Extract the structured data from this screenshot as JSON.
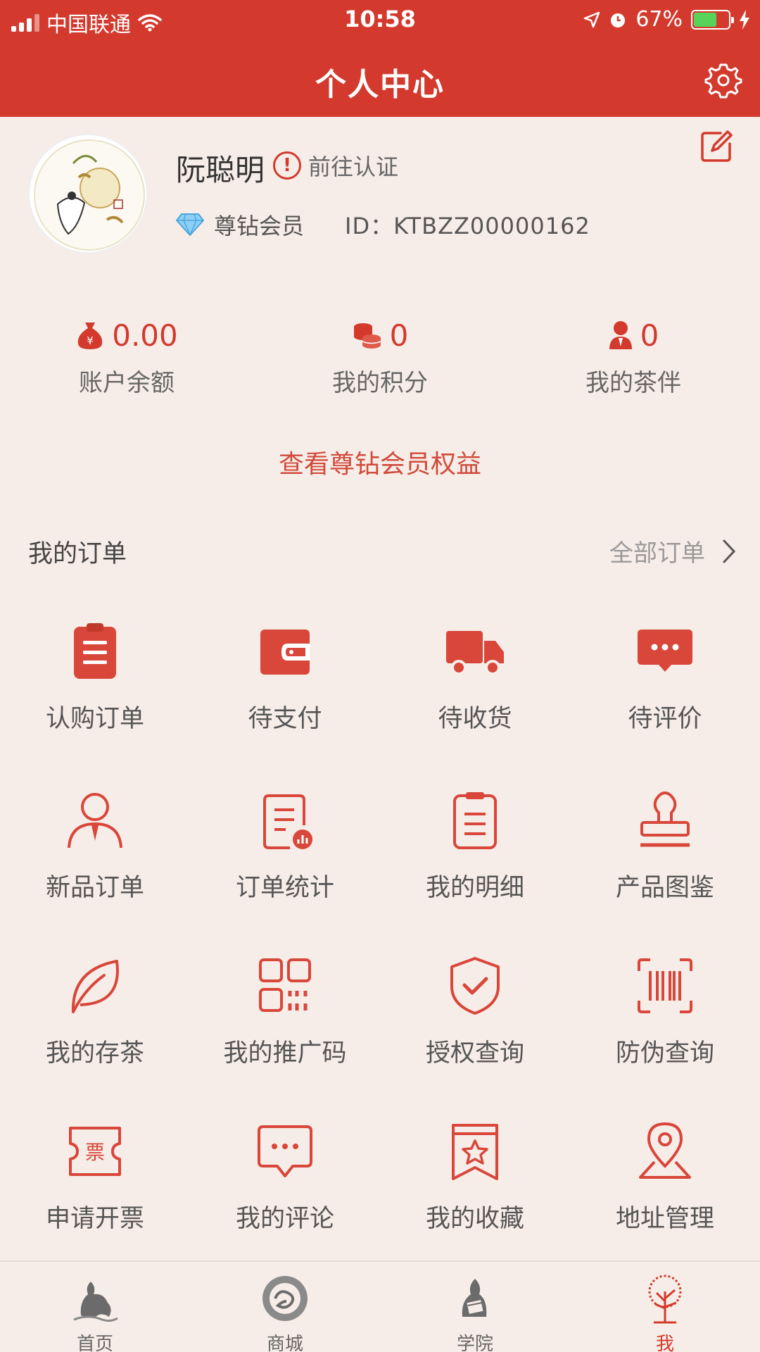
{
  "status_bar": {
    "carrier": "中国联通",
    "time": "10:58",
    "battery": "67%",
    "battery_level": 0.67
  },
  "header": {
    "title": "个人中心"
  },
  "profile": {
    "name": "阮聪明",
    "verify_label": "前往认证",
    "verify_mark": "!",
    "membership": "尊钻会员",
    "id_label": "ID：KTBZZ00000162"
  },
  "stats": [
    {
      "value": "0.00",
      "label": "账户余额",
      "icon": "money-bag-icon"
    },
    {
      "value": "0",
      "label": "我的积分",
      "icon": "coins-icon"
    },
    {
      "value": "0",
      "label": "我的茶伴",
      "icon": "person-icon"
    }
  ],
  "benefits_link": "查看尊钻会员权益",
  "orders": {
    "title": "我的订单",
    "all_label": "全部订单",
    "items": [
      {
        "label": "认购订单",
        "icon": "clipboard-icon"
      },
      {
        "label": "待支付",
        "icon": "wallet-icon"
      },
      {
        "label": "待收货",
        "icon": "truck-icon"
      },
      {
        "label": "待评价",
        "icon": "chat-bubble-icon"
      }
    ]
  },
  "services": [
    {
      "label": "新品订单",
      "icon": "user-icon"
    },
    {
      "label": "订单统计",
      "icon": "report-icon"
    },
    {
      "label": "我的明细",
      "icon": "list-icon"
    },
    {
      "label": "产品图鉴",
      "icon": "stamp-icon"
    },
    {
      "label": "我的存茶",
      "icon": "leaf-icon"
    },
    {
      "label": "我的推广码",
      "icon": "qr-code-icon"
    },
    {
      "label": "授权查询",
      "icon": "shield-check-icon"
    },
    {
      "label": "防伪查询",
      "icon": "barcode-scan-icon"
    },
    {
      "label": "申请开票",
      "icon": "ticket-icon",
      "glyph": "票"
    },
    {
      "label": "我的评论",
      "icon": "comment-icon"
    },
    {
      "label": "我的收藏",
      "icon": "bookmark-star-icon"
    },
    {
      "label": "地址管理",
      "icon": "map-pin-icon"
    }
  ],
  "tabs": [
    {
      "label": "首页",
      "icon": "home-ink-icon"
    },
    {
      "label": "商城",
      "icon": "mall-ink-icon"
    },
    {
      "label": "学院",
      "icon": "academy-ink-icon"
    },
    {
      "label": "我",
      "icon": "me-tree-icon"
    }
  ],
  "colors": {
    "brand": "#d33a2d",
    "background": "#f7ede8"
  }
}
